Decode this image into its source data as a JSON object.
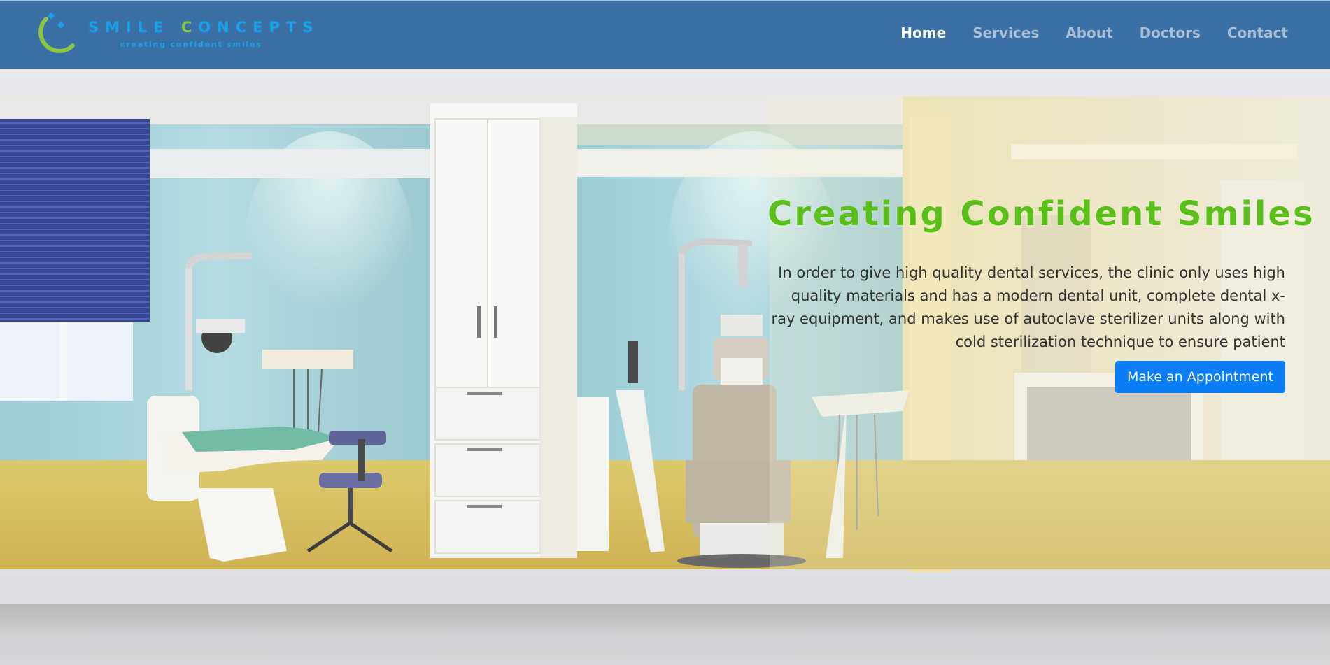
{
  "brand": {
    "name_part1": "SMILE ",
    "name_accent": "C",
    "name_part2": "ONCEPTS",
    "tagline": "creating confident smiles"
  },
  "nav": {
    "items": [
      {
        "label": "Home",
        "active": true
      },
      {
        "label": "Services",
        "active": false
      },
      {
        "label": "About",
        "active": false
      },
      {
        "label": "Doctors",
        "active": false
      },
      {
        "label": "Contact",
        "active": false
      }
    ]
  },
  "hero": {
    "title": "Creating Confident Smiles",
    "description": "In order to give high quality dental services, the clinic only uses high quality materials and has a modern dental unit, complete dental x-ray equipment, and makes use of autoclave sterilizer units along with cold sterilization technique to ensure patient",
    "cta_label": "Make an Appointment"
  },
  "colors": {
    "navbar": "#3a70a6",
    "brand_blue": "#19a0e6",
    "brand_green": "#8cc63f",
    "title_green": "#5bbf1a",
    "cta_blue": "#0b7df5"
  }
}
